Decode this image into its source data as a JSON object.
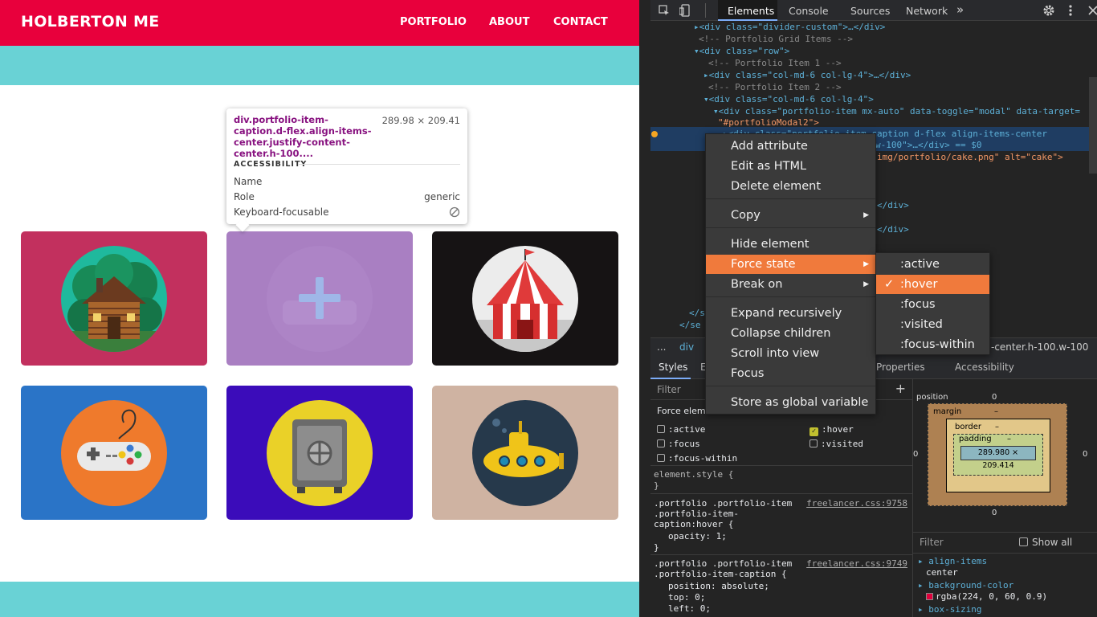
{
  "site": {
    "brand": "HOLBERTON ME",
    "nav": [
      "PORTFOLIO",
      "ABOUT",
      "CONTACT"
    ],
    "colors": {
      "nav_bg": "#e8003c",
      "band": "#69d2d5"
    },
    "portfolio": [
      {
        "icon": "cabin-icon",
        "tile_color": "#c2305e",
        "disc_color": "#1fb99d"
      },
      {
        "icon": "cake-icon",
        "tile_color": "#9b6fb0",
        "disc_color": "#9b6fb0",
        "hovered": true
      },
      {
        "icon": "circus-tent-icon",
        "tile_color": "#161314",
        "disc_color": "#ececec"
      },
      {
        "icon": "game-controller-icon",
        "tile_color": "#2a74c7",
        "disc_color": "#ef7a2c"
      },
      {
        "icon": "safe-icon",
        "tile_color": "#3b0cba",
        "disc_color": "#ead128"
      },
      {
        "icon": "submarine-icon",
        "tile_color": "#cfb3a2",
        "disc_color": "#26394b"
      }
    ]
  },
  "tooltip": {
    "selector": "div.portfolio-item-caption.d-flex.align-items-center.justify-content-center.h-100....",
    "size": "289.98 × 209.41",
    "section": "ACCESSIBILITY",
    "rows": [
      {
        "label": "Name",
        "value": ""
      },
      {
        "label": "Role",
        "value": "generic"
      },
      {
        "label": "Keyboard-focusable",
        "value": ""
      }
    ]
  },
  "devtools": {
    "tabs": [
      "Elements",
      "Console",
      "Sources",
      "Network"
    ],
    "more_tabs": "»",
    "dom_lines": [
      "▸<div class=\"divider-custom\">…</div>",
      "<!-- Portfolio Grid Items -->",
      "▾<div class=\"row\">",
      "<!-- Portfolio Item 1 -->",
      "▸<div class=\"col-md-6 col-lg-4\">…</div>",
      "<!-- Portfolio Item 2 -->",
      "▾<div class=\"col-md-6 col-lg-4\">",
      "▾<div class=\"portfolio-item mx-auto\" data-toggle=\"modal\" data-target=",
      "\"#portfolioModal2\">",
      "▸<div class=\"portfolio-item-caption d-flex align-items-center",
      "w-100\">…</div> == $0",
      "img/portfolio/cake.png\" alt=\"cake\">",
      "</div>",
      "</div>",
      "</s",
      "</se"
    ],
    "breadcrumb": [
      "...",
      "div",
      "-center.h-100.w-100"
    ],
    "subtabs": [
      "Styles",
      "E",
      "Properties",
      "Accessibility"
    ],
    "filter_placeholder": "Filter",
    "force_element_state": "Force elem",
    "states": [
      {
        "name": ":active",
        "checked": false
      },
      {
        "name": ":hover",
        "checked": true
      },
      {
        "name": ":focus",
        "checked": false
      },
      {
        "name": ":visited",
        "checked": false
      },
      {
        "name": ":focus-within",
        "checked": false
      }
    ],
    "css_rules": [
      {
        "selector": "element.style {",
        "close": "}"
      },
      {
        "selector": ".portfolio .portfolio-item\n.portfolio-item-\ncaption:hover {",
        "source": "freelancer.css:9758",
        "decls": [
          "opacity: 1;"
        ],
        "close": "}"
      },
      {
        "selector": ".portfolio .portfolio-item\n.portfolio-item-caption {",
        "source": "freelancer.css:9749",
        "decls": [
          "position: absolute;",
          "top: 0;",
          "left: 0;"
        ]
      }
    ],
    "box_model": {
      "position_label": "position",
      "position_value": "0",
      "margin_label": "margin",
      "margin_value": "–",
      "border_label": "border",
      "border_value": "–",
      "padding_label": "padding",
      "padding_value": "–",
      "content": "289.980 × 209.414",
      "side_value": "0"
    },
    "computed": {
      "filter_placeholder": "Filter",
      "show_all": "Show all",
      "props": [
        {
          "name": "align-items",
          "value": "center"
        },
        {
          "name": "background-color",
          "value": "rgba(224, 0, 60, 0.9)",
          "swatch": "#e0003c"
        },
        {
          "name": "box-sizing",
          "value": ""
        }
      ]
    },
    "context_menu": [
      "Add attribute",
      "Edit as HTML",
      "Delete element",
      "Copy",
      "Hide element",
      "Force state",
      "Break on",
      "Expand recursively",
      "Collapse children",
      "Scroll into view",
      "Focus",
      "Store as global variable"
    ],
    "force_state_submenu": [
      ":active",
      ":hover",
      ":focus",
      ":visited",
      ":focus-within"
    ],
    "accent": "#f07a3c"
  }
}
